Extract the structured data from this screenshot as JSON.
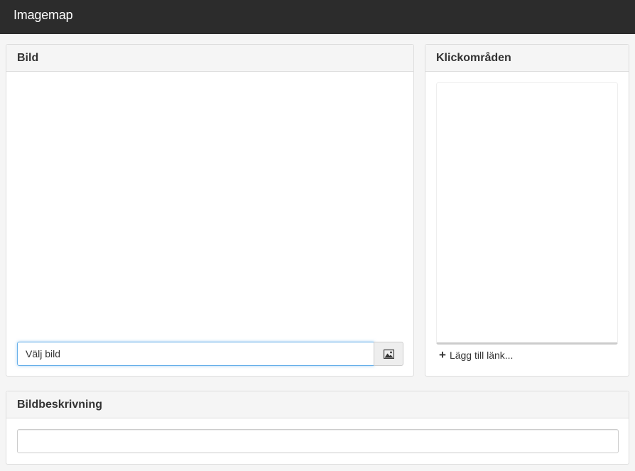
{
  "app": {
    "title": "Imagemap"
  },
  "image_panel": {
    "heading": "Bild",
    "input_value": "Välj bild",
    "button_icon": "image-icon"
  },
  "areas_panel": {
    "heading": "Klickområden",
    "add_link_label": "Lägg till länk...",
    "add_icon": "plus-icon"
  },
  "description_panel": {
    "heading": "Bildbeskrivning",
    "input_value": ""
  },
  "colors": {
    "topbar": "#2c2c2c",
    "focus_border": "#66afe9"
  }
}
